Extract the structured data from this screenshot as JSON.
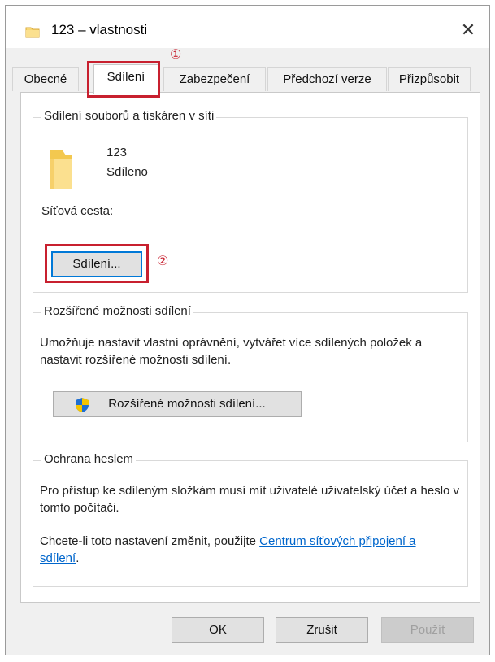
{
  "window": {
    "title": "123 – vlastnosti",
    "close_glyph": "✕"
  },
  "tabs": [
    {
      "label": "Obecné",
      "active": false
    },
    {
      "label": "Sdílení",
      "active": true
    },
    {
      "label": "Zabezpečení",
      "active": false
    },
    {
      "label": "Předchozí verze",
      "active": false
    },
    {
      "label": "Přizpůsobit",
      "active": false
    }
  ],
  "callouts": {
    "step1": "①",
    "step2": "②",
    "color": "#c8202f"
  },
  "sharing_group": {
    "title": "Sdílení souborů a tiskáren v síti",
    "folder_name": "123",
    "folder_status": "Sdíleno",
    "network_path_label": "Síťová cesta:",
    "share_button": "Sdílení..."
  },
  "advanced_group": {
    "title": "Rozšířené možnosti sdílení",
    "description": "Umožňuje nastavit vlastní oprávnění, vytvářet více sdílených položek a nastavit rozšířené možnosti sdílení.",
    "button": "Rozšířené možnosti sdílení..."
  },
  "password_group": {
    "title": "Ochrana heslem",
    "description": "Pro přístup ke sdíleným složkám musí mít uživatelé uživatelský účet a heslo v tomto počítači.",
    "change_text": "Chcete-li toto nastavení změnit, použijte ",
    "link_text": "Centrum síťových připojení a sdílení",
    "change_suffix": "."
  },
  "footer": {
    "ok": "OK",
    "cancel": "Zrušit",
    "apply": "Použít"
  },
  "colors": {
    "accent": "#0078d7",
    "link": "#0066cc",
    "folder": "#f8d775"
  }
}
